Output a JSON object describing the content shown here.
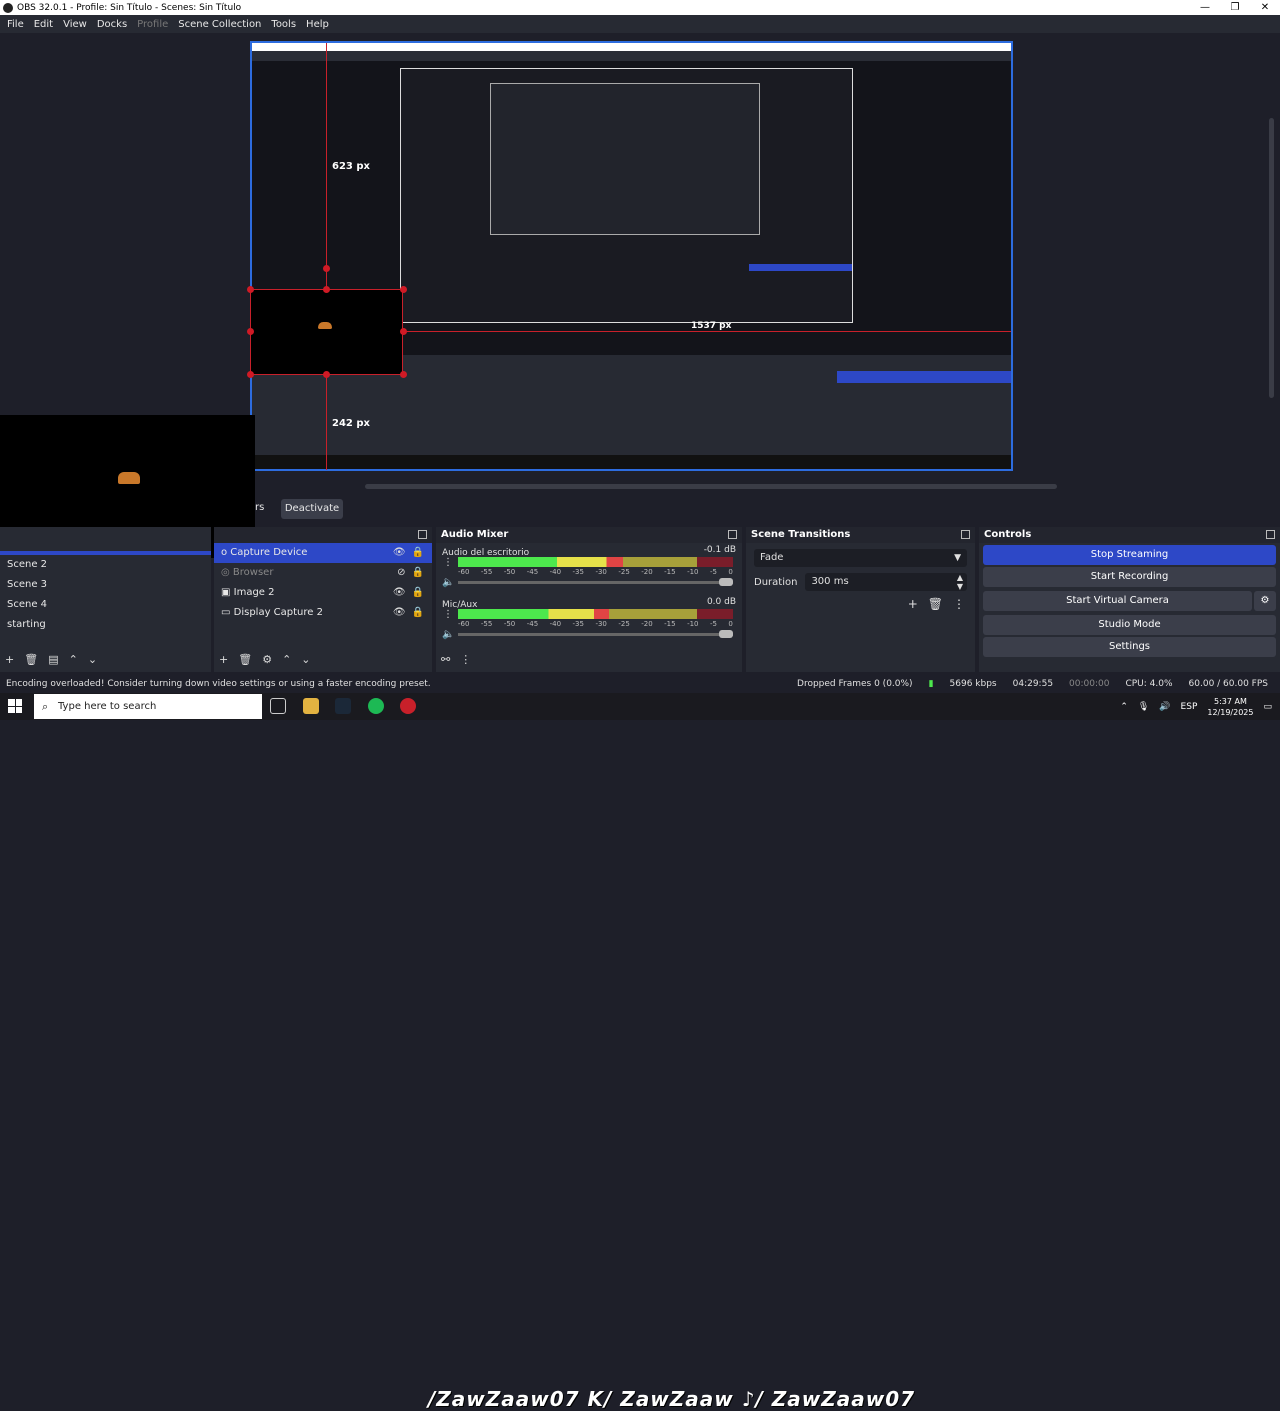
{
  "window": {
    "title": "OBS 32.0.1 - Profile: Sin Título - Scenes: Sin Título",
    "min": "—",
    "max": "❐",
    "close": "✕"
  },
  "menu": {
    "file": "File",
    "edit": "Edit",
    "view": "View",
    "docks": "Docks",
    "profile": "Profile",
    "scene_collection": "Scene Collection",
    "tools": "Tools",
    "help": "Help"
  },
  "preview": {
    "label_623": "623 px",
    "label_242": "242 px",
    "label_1537": "1537 px"
  },
  "filters_partial": "rs",
  "deactivate": "Deactivate",
  "scenes": {
    "items": [
      "Scene 2",
      "Scene 3",
      "Scene 4",
      "starting"
    ]
  },
  "sources": {
    "items": [
      {
        "label": "o Capture Device"
      },
      {
        "label": "Browser"
      },
      {
        "label": "Image 2"
      },
      {
        "label": "Display Capture 2"
      }
    ]
  },
  "mixer": {
    "title": "Audio Mixer",
    "channels": [
      {
        "name": "Audio del escritorio",
        "db": "-0.1 dB",
        "level": 0.6
      },
      {
        "name": "Mic/Aux",
        "db": "0.0 dB",
        "level": 0.55
      }
    ],
    "ticks": [
      "-60",
      "-55",
      "-50",
      "-45",
      "-40",
      "-35",
      "-30",
      "-25",
      "-20",
      "-15",
      "-10",
      "-5",
      "0"
    ]
  },
  "transitions": {
    "title": "Scene Transitions",
    "selected": "Fade",
    "duration_label": "Duration",
    "duration_value": "300 ms"
  },
  "controls": {
    "title": "Controls",
    "stop_streaming": "Stop Streaming",
    "start_recording": "Start Recording",
    "start_virtual_camera": "Start Virtual Camera",
    "studio_mode": "Studio Mode",
    "settings": "Settings"
  },
  "status": {
    "message": "Encoding overloaded! Consider turning down video settings or using a faster encoding preset.",
    "dropped": "Dropped Frames 0 (0.0%)",
    "bitrate": "5696 kbps",
    "stream_time": "04:29:55",
    "rec_time": "00:00:00",
    "cpu": "CPU: 4.0%",
    "fps": "60.00 / 60.00 FPS"
  },
  "taskbar": {
    "search_placeholder": "Type here to search",
    "banner": "/ZawZaaw07 K/ ZawZaaw ♪/ ZawZaaw07",
    "lang": "ESP",
    "time": "5:37 AM",
    "date": "12/19/2025"
  },
  "colors": {
    "accent": "#2d48c7",
    "selection": "#c8202a"
  }
}
